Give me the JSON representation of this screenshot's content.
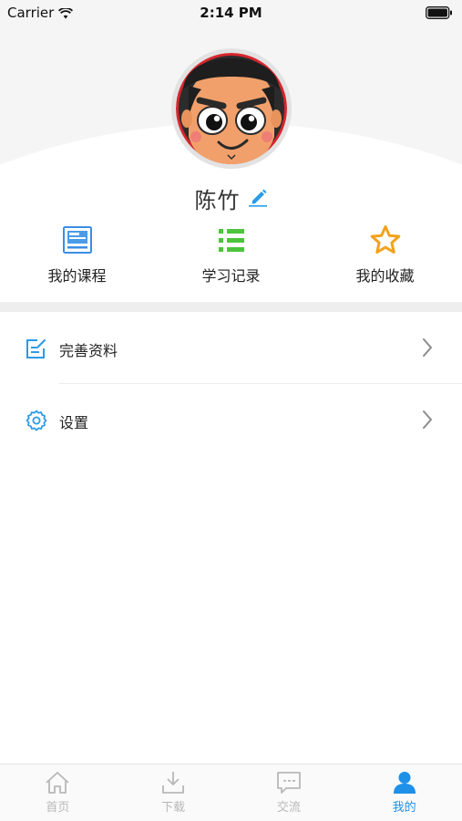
{
  "status_bar": {
    "carrier": "Carrier",
    "time": "2:14 PM"
  },
  "profile": {
    "name": "陈竹",
    "avatar_icon": "cartoon-avatar",
    "edit_icon": "pencil-icon"
  },
  "quick_actions": [
    {
      "label": "我的课程",
      "icon": "newspaper-icon",
      "color": "#3a8ee6"
    },
    {
      "label": "学习记录",
      "icon": "list-icon",
      "color": "#4cc43b"
    },
    {
      "label": "我的收藏",
      "icon": "star-icon",
      "color": "#f3a21c"
    }
  ],
  "menu": [
    {
      "label": "完善资料",
      "icon": "edit-form-icon"
    },
    {
      "label": "设置",
      "icon": "gear-icon"
    }
  ],
  "tabs": [
    {
      "label": "首页",
      "icon": "home-icon",
      "active": false
    },
    {
      "label": "下载",
      "icon": "download-icon",
      "active": false
    },
    {
      "label": "交流",
      "icon": "chat-icon",
      "active": false
    },
    {
      "label": "我的",
      "icon": "user-icon",
      "active": true
    }
  ],
  "colors": {
    "accent": "#1e90e8",
    "inactive": "#b8b8b8",
    "menu_icon": "#2a9be8"
  }
}
